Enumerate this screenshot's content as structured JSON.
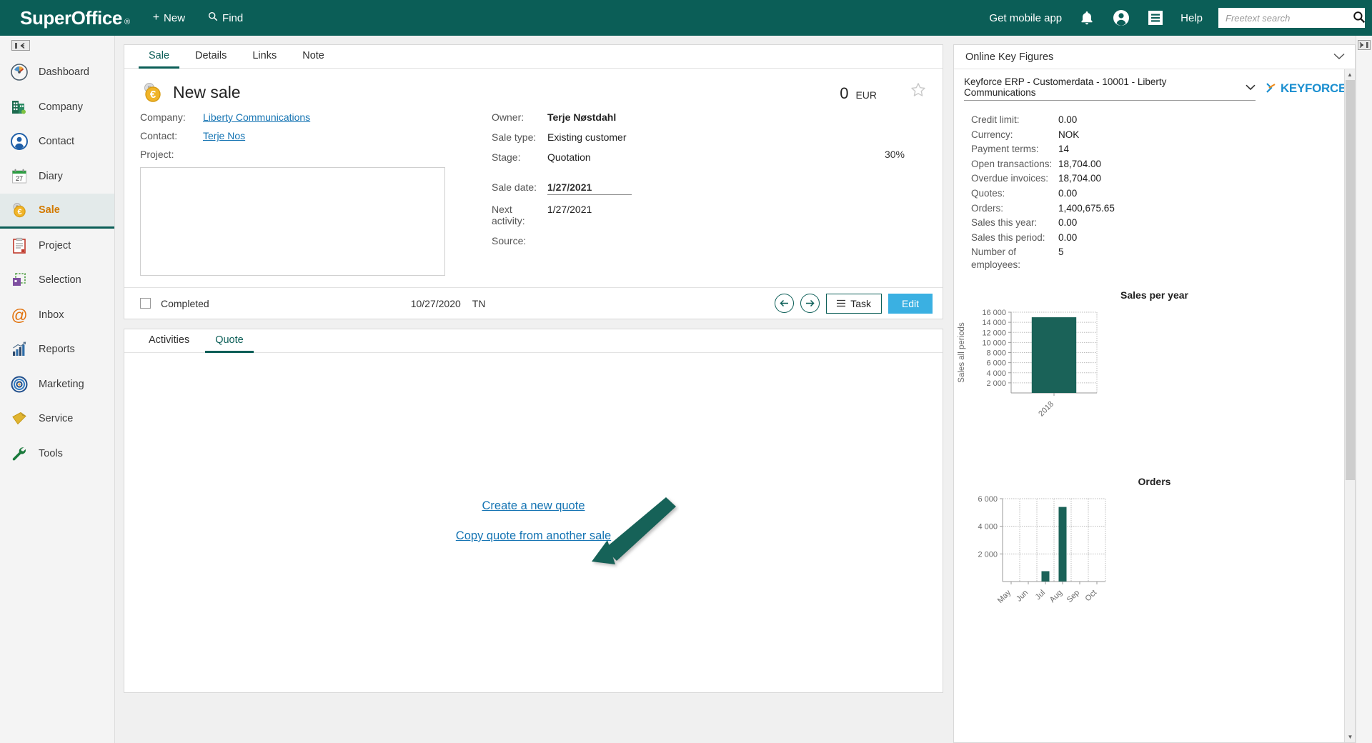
{
  "topbar": {
    "logo": "SuperOffice",
    "logo_mark": "®",
    "new_label": "New",
    "find_label": "Find",
    "get_mobile_app": "Get mobile app",
    "help_label": "Help",
    "search_placeholder": "Freetext search",
    "search_value": "",
    "brand_color": "#0b5e57"
  },
  "sidebar": {
    "collapse_label": "◧←",
    "items": [
      {
        "label": "Dashboard",
        "icon": "gauge-icon",
        "active": false
      },
      {
        "label": "Company",
        "icon": "building-icon",
        "active": false
      },
      {
        "label": "Contact",
        "icon": "person-icon",
        "active": false
      },
      {
        "label": "Diary",
        "icon": "calendar-icon",
        "active": false,
        "day": "27"
      },
      {
        "label": "Sale",
        "icon": "coin-euro-icon",
        "active": true
      },
      {
        "label": "Project",
        "icon": "clipboard-icon",
        "active": false
      },
      {
        "label": "Selection",
        "icon": "selection-icon",
        "active": false
      },
      {
        "label": "Inbox",
        "icon": "at-sign-icon",
        "active": false
      },
      {
        "label": "Reports",
        "icon": "bar-chart-icon",
        "active": false
      },
      {
        "label": "Marketing",
        "icon": "target-icon",
        "active": false
      },
      {
        "label": "Service",
        "icon": "ticket-icon",
        "active": false
      },
      {
        "label": "Tools",
        "icon": "wrench-icon",
        "active": false
      }
    ]
  },
  "sale_card": {
    "tabs": [
      {
        "label": "Sale",
        "active": true
      },
      {
        "label": "Details",
        "active": false
      },
      {
        "label": "Links",
        "active": false
      },
      {
        "label": "Note",
        "active": false
      }
    ],
    "title": "New sale",
    "amount": "0",
    "currency": "EUR",
    "left_fields": [
      {
        "label": "Company:",
        "value": "Liberty Communications",
        "is_link": true
      },
      {
        "label": "Contact:",
        "value": "Terje Nos",
        "is_link": true
      },
      {
        "label": "Project:",
        "value": "",
        "is_link": false
      }
    ],
    "right_fields": [
      {
        "label": "Owner:",
        "value": "Terje Nøstdahl",
        "bold": true
      },
      {
        "label": "Sale type:",
        "value": "Existing customer",
        "bold": false
      },
      {
        "label": "Stage:",
        "value": "Quotation",
        "bold": false
      }
    ],
    "date_fields": [
      {
        "label": "Sale date:",
        "value": "1/27/2021",
        "underlined": true
      },
      {
        "label": "Next activity:",
        "value": "1/27/2021",
        "underlined": false
      },
      {
        "label": "Source:",
        "value": "",
        "underlined": false
      }
    ],
    "probability": "30%",
    "note_value": "",
    "footer": {
      "completed_label": "Completed",
      "completed_checked": false,
      "date": "10/27/2020",
      "initials": "TN",
      "prev_icon": "arrow-left-icon",
      "next_icon": "arrow-right-icon",
      "task_label": "Task",
      "edit_label": "Edit",
      "edit_color": "#3ab0e2"
    }
  },
  "quote_card": {
    "tabs": [
      {
        "label": "Activities",
        "active": false
      },
      {
        "label": "Quote",
        "active": true
      }
    ],
    "links": [
      {
        "label": "Create a new quote"
      },
      {
        "label": "Copy quote from another sale"
      }
    ],
    "annotation": {
      "type": "arrow",
      "color": "#1a6e63",
      "points_to": "Create a new quote"
    }
  },
  "right_panel": {
    "title": "Online Key Figures",
    "erp_selection": "Keyforce ERP - Customerdata - 10001 - Liberty Communications",
    "vendor_logo": "KEYFORCE",
    "vendor_color": "#1b8fd0",
    "figures": [
      {
        "label": "Credit limit:",
        "value": "0.00"
      },
      {
        "label": "Currency:",
        "value": "NOK"
      },
      {
        "label": "Payment terms:",
        "value": "14"
      },
      {
        "label": "Open transactions:",
        "value": "18,704.00"
      },
      {
        "label": "Overdue invoices:",
        "value": "18,704.00"
      },
      {
        "label": "Quotes:",
        "value": "0.00"
      },
      {
        "label": "Orders:",
        "value": "1,400,675.65"
      },
      {
        "label": "Sales this year:",
        "value": "0.00"
      },
      {
        "label": "Sales this period:",
        "value": "0.00"
      },
      {
        "label": "Number of employees:",
        "value": "5"
      }
    ]
  },
  "chart_data": [
    {
      "type": "bar",
      "title": "Sales per year",
      "categories": [
        "2018"
      ],
      "values": [
        15000
      ],
      "xlabel": "",
      "ylabel": "Sales all periods",
      "ylim": [
        0,
        16000
      ],
      "yticks": [
        2000,
        4000,
        6000,
        8000,
        10000,
        12000,
        14000,
        16000
      ],
      "ytick_labels": [
        "2 000",
        "4 000",
        "6 000",
        "8 000",
        "10 000",
        "12 000",
        "14 000",
        "16 000"
      ],
      "grid": true,
      "legend": false,
      "bar_color": "#1a6258"
    },
    {
      "type": "bar",
      "title": "Orders",
      "categories": [
        "May",
        "Jun",
        "Jul",
        "Aug",
        "Sep",
        "Oct"
      ],
      "values": [
        0,
        0,
        750,
        5400,
        0,
        0
      ],
      "xlabel": "",
      "ylabel": "",
      "ylim": [
        0,
        6000
      ],
      "yticks": [
        2000,
        4000,
        6000
      ],
      "ytick_labels": [
        "2 000",
        "4 000",
        "6 000"
      ],
      "grid": true,
      "legend": false,
      "bar_color": "#1a6258"
    }
  ],
  "far_right": {
    "expand_label": "→|"
  }
}
